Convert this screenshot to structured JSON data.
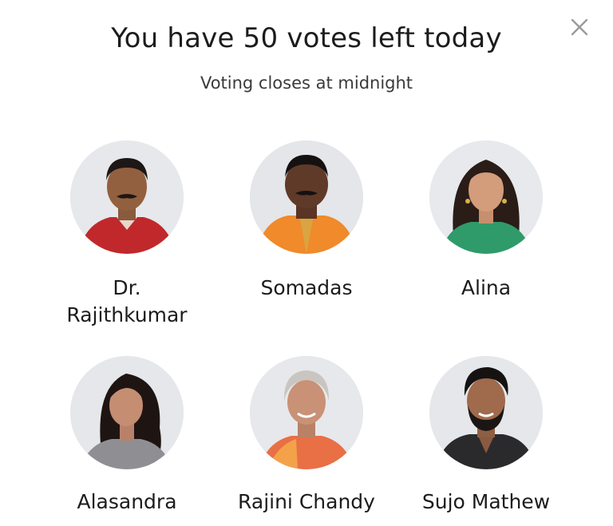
{
  "header": {
    "title": "You have 50 votes left today",
    "subtitle": "Voting closes at midnight",
    "close_icon": "close-icon"
  },
  "contestants": [
    {
      "name": "Dr. Rajithkumar",
      "photo": "photo-man-red-shirt"
    },
    {
      "name": "Somadas",
      "photo": "photo-man-orange-kurta"
    },
    {
      "name": "Alina",
      "photo": "photo-woman-green-top"
    },
    {
      "name": "Alasandra",
      "photo": "photo-woman-grey-saree"
    },
    {
      "name": "Rajini Chandy",
      "photo": "photo-woman-orange-saree"
    },
    {
      "name": "Sujo Mathew",
      "photo": "photo-man-black-shirt"
    }
  ],
  "colors": {
    "background": "#ffffff",
    "text": "#1c1c1e",
    "subtitle": "#3a3a3c",
    "close": "#9a9a9e",
    "avatar_bg": "#e8e9ec"
  }
}
